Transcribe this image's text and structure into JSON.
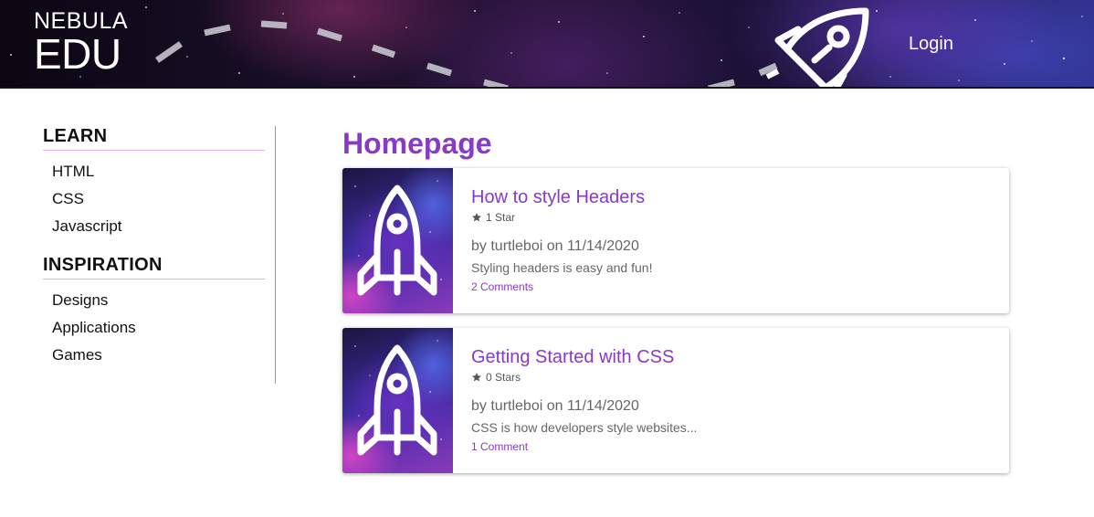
{
  "header": {
    "logo_top": "NEBULA",
    "logo_bottom": "EDU",
    "login_label": "Login"
  },
  "sidebar": {
    "sections": [
      {
        "heading": "LEARN",
        "items": [
          "HTML",
          "CSS",
          "Javascript"
        ]
      },
      {
        "heading": "INSPIRATION",
        "items": [
          "Designs",
          "Applications",
          "Games"
        ]
      }
    ]
  },
  "main": {
    "title": "Homepage",
    "posts": [
      {
        "title": "How to style Headers",
        "stars": "1 Star",
        "byline": "by turtleboi on 11/14/2020",
        "excerpt": "Styling headers is easy and fun!",
        "comments": "2 Comments"
      },
      {
        "title": "Getting Started with CSS",
        "stars": "0 Stars",
        "byline": "by turtleboi on 11/14/2020",
        "excerpt": "CSS is how developers style websites...",
        "comments": "1 Comment"
      }
    ]
  },
  "colors": {
    "accent": "#8a38c9",
    "sidebar_divider": "#e6b2e6",
    "header_bg": "#1a0f2a"
  },
  "icons": [
    "rocket-icon",
    "star-icon"
  ]
}
